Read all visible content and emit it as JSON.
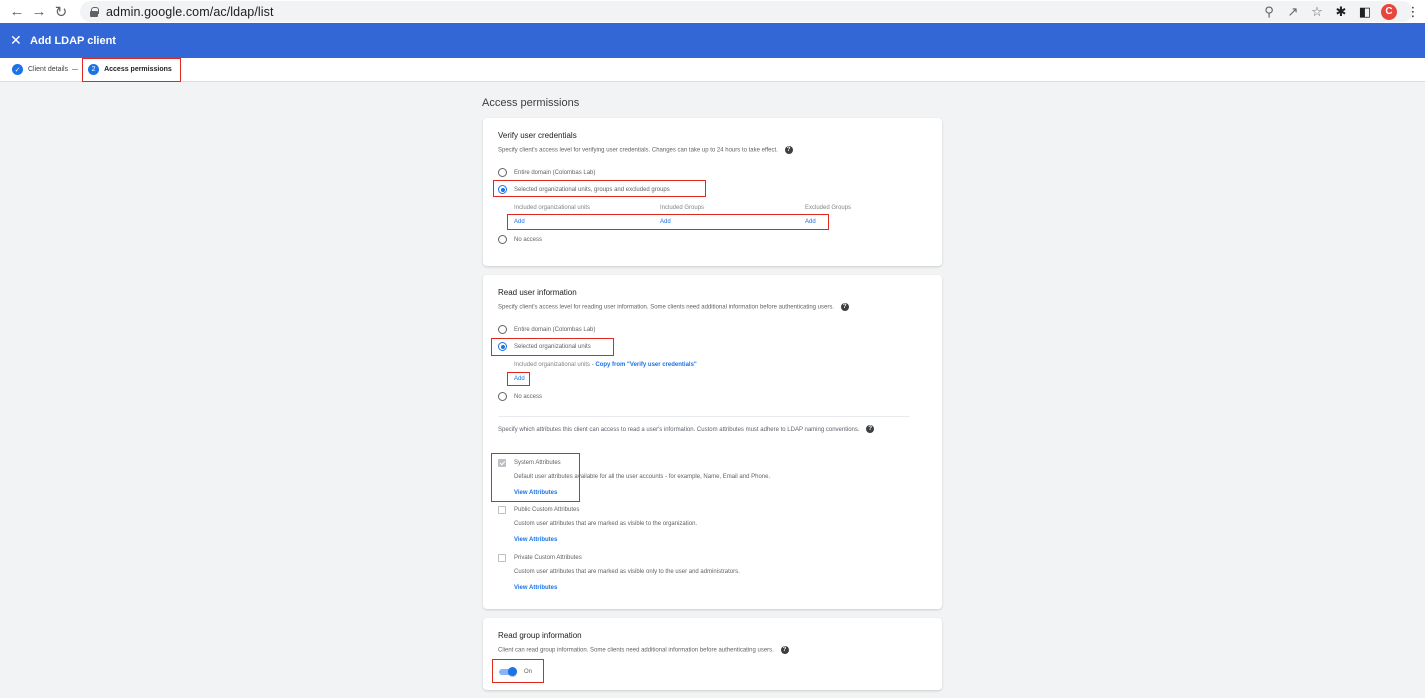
{
  "browser": {
    "url": "admin.google.com/ac/ldap/list",
    "profile_initial": "C",
    "icons": [
      "back-arrow-icon",
      "forward-arrow-icon",
      "reload-icon",
      "lock-icon",
      "zoom-icon",
      "share-icon",
      "star-icon",
      "extensions-icon",
      "side-panel-icon",
      "menu-dots-icon"
    ]
  },
  "appbar": {
    "title": "Add LDAP client",
    "close_icon": "close-icon"
  },
  "stepper": {
    "step1": {
      "label": "Client details",
      "state": "complete"
    },
    "step2": {
      "number": "2",
      "label": "Access permissions",
      "state": "active"
    }
  },
  "page": {
    "heading": "Access permissions"
  },
  "verify": {
    "title": "Verify user credentials",
    "desc": "Specify client's access level for verifying user credentials. Changes can take up to 24 hours to take effect.",
    "opt_entire": "Entire domain (Colombas Lab)",
    "opt_selected": "Selected organizational units, groups and excluded groups",
    "opt_none": "No access",
    "selected_option": "opt_selected",
    "col_ou": "Included organizational units",
    "col_groups": "Included Groups",
    "col_excluded": "Excluded Groups",
    "add": "Add"
  },
  "read": {
    "title": "Read user information",
    "desc": "Specify client's access level for reading user information. Some clients need additional information before authenticating users.",
    "opt_entire": "Entire domain (Colombas Lab)",
    "opt_selected": "Selected organizational units",
    "opt_none": "No access",
    "selected_option": "opt_selected",
    "included_label": "Included organizational units -",
    "copy_link": "Copy from \"Verify user credentials\"",
    "add": "Add",
    "attr_note": "Specify which attributes this client can access to read a user's information. Custom attributes must adhere to LDAP naming conventions.",
    "system_title": "System Attributes",
    "system_desc": "Default user attributes available for all the user accounts - for example, Name, Email and Phone.",
    "system_checked": true,
    "public_title": "Public Custom Attributes",
    "public_desc": "Custom user attributes that are marked as visible to the organization.",
    "public_checked": false,
    "private_title": "Private Custom Attributes",
    "private_desc": "Custom user attributes that are marked as visible only to the user and administrators.",
    "private_checked": false,
    "view": "View Attributes"
  },
  "group": {
    "title": "Read group information",
    "desc": "Client can read group information. Some clients need additional information before authenticating users.",
    "toggle_label": "On",
    "toggle_on": true
  },
  "colors": {
    "appbar": "#3367d6",
    "accent": "#1a73e8",
    "highlight": "#e0281f",
    "page_bg": "#f1f3f4"
  }
}
